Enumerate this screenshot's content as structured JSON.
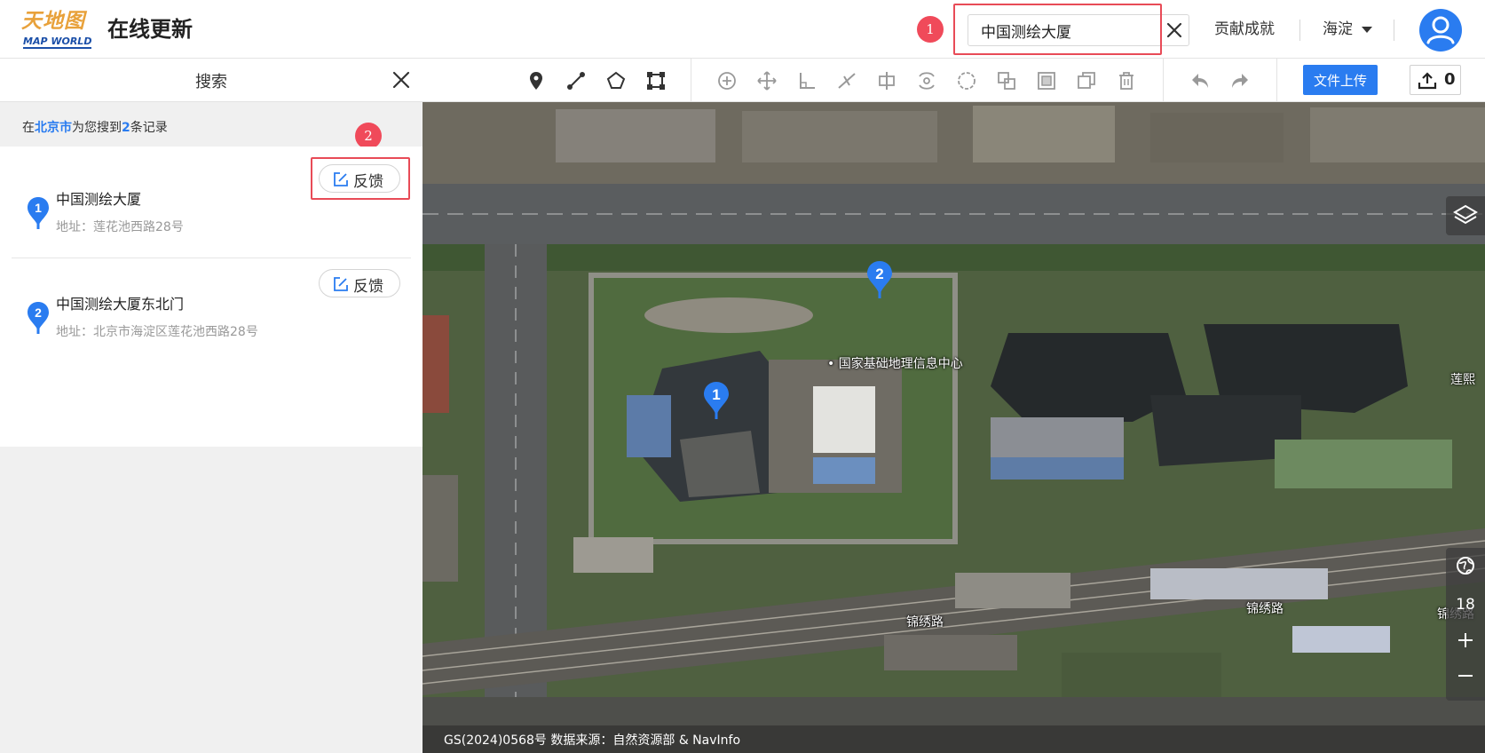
{
  "header": {
    "logo_cn": "天地图",
    "logo_en": "MAP WORLD",
    "app_title": "在线更新",
    "search_value": "中国测绘大厦",
    "contrib_link": "贡献成就",
    "region_label": "海淀"
  },
  "annotations": {
    "marker1": "1",
    "marker2": "2"
  },
  "panel": {
    "title": "搜索",
    "summary_prefix": "在",
    "summary_city": "北京市",
    "summary_mid": "为您搜到",
    "summary_count": "2",
    "summary_suffix": "条记录",
    "results": [
      {
        "index": "1",
        "name": "中国测绘大厦",
        "address": "地址：莲花池西路28号",
        "feedback": "反馈"
      },
      {
        "index": "2",
        "name": "中国测绘大厦东北门",
        "address": "地址：北京市海淀区莲花池西路28号",
        "feedback": "反馈"
      }
    ]
  },
  "toolbar": {
    "upload_label": "文件上传",
    "pending_count": "0"
  },
  "map": {
    "label_center": "国家基础地理信息中心",
    "label_road1": "锦绣路",
    "label_road2": "锦绣路",
    "label_road3": "锦绣路",
    "label_edge": "莲熙",
    "pin1": "1",
    "pin2": "2",
    "zoom_level": "18",
    "footer": "GS(2024)0568号   数据来源：自然资源部 & NavInfo"
  },
  "colors": {
    "accent": "#2a7cf0",
    "annotation_red": "#e84b57"
  }
}
